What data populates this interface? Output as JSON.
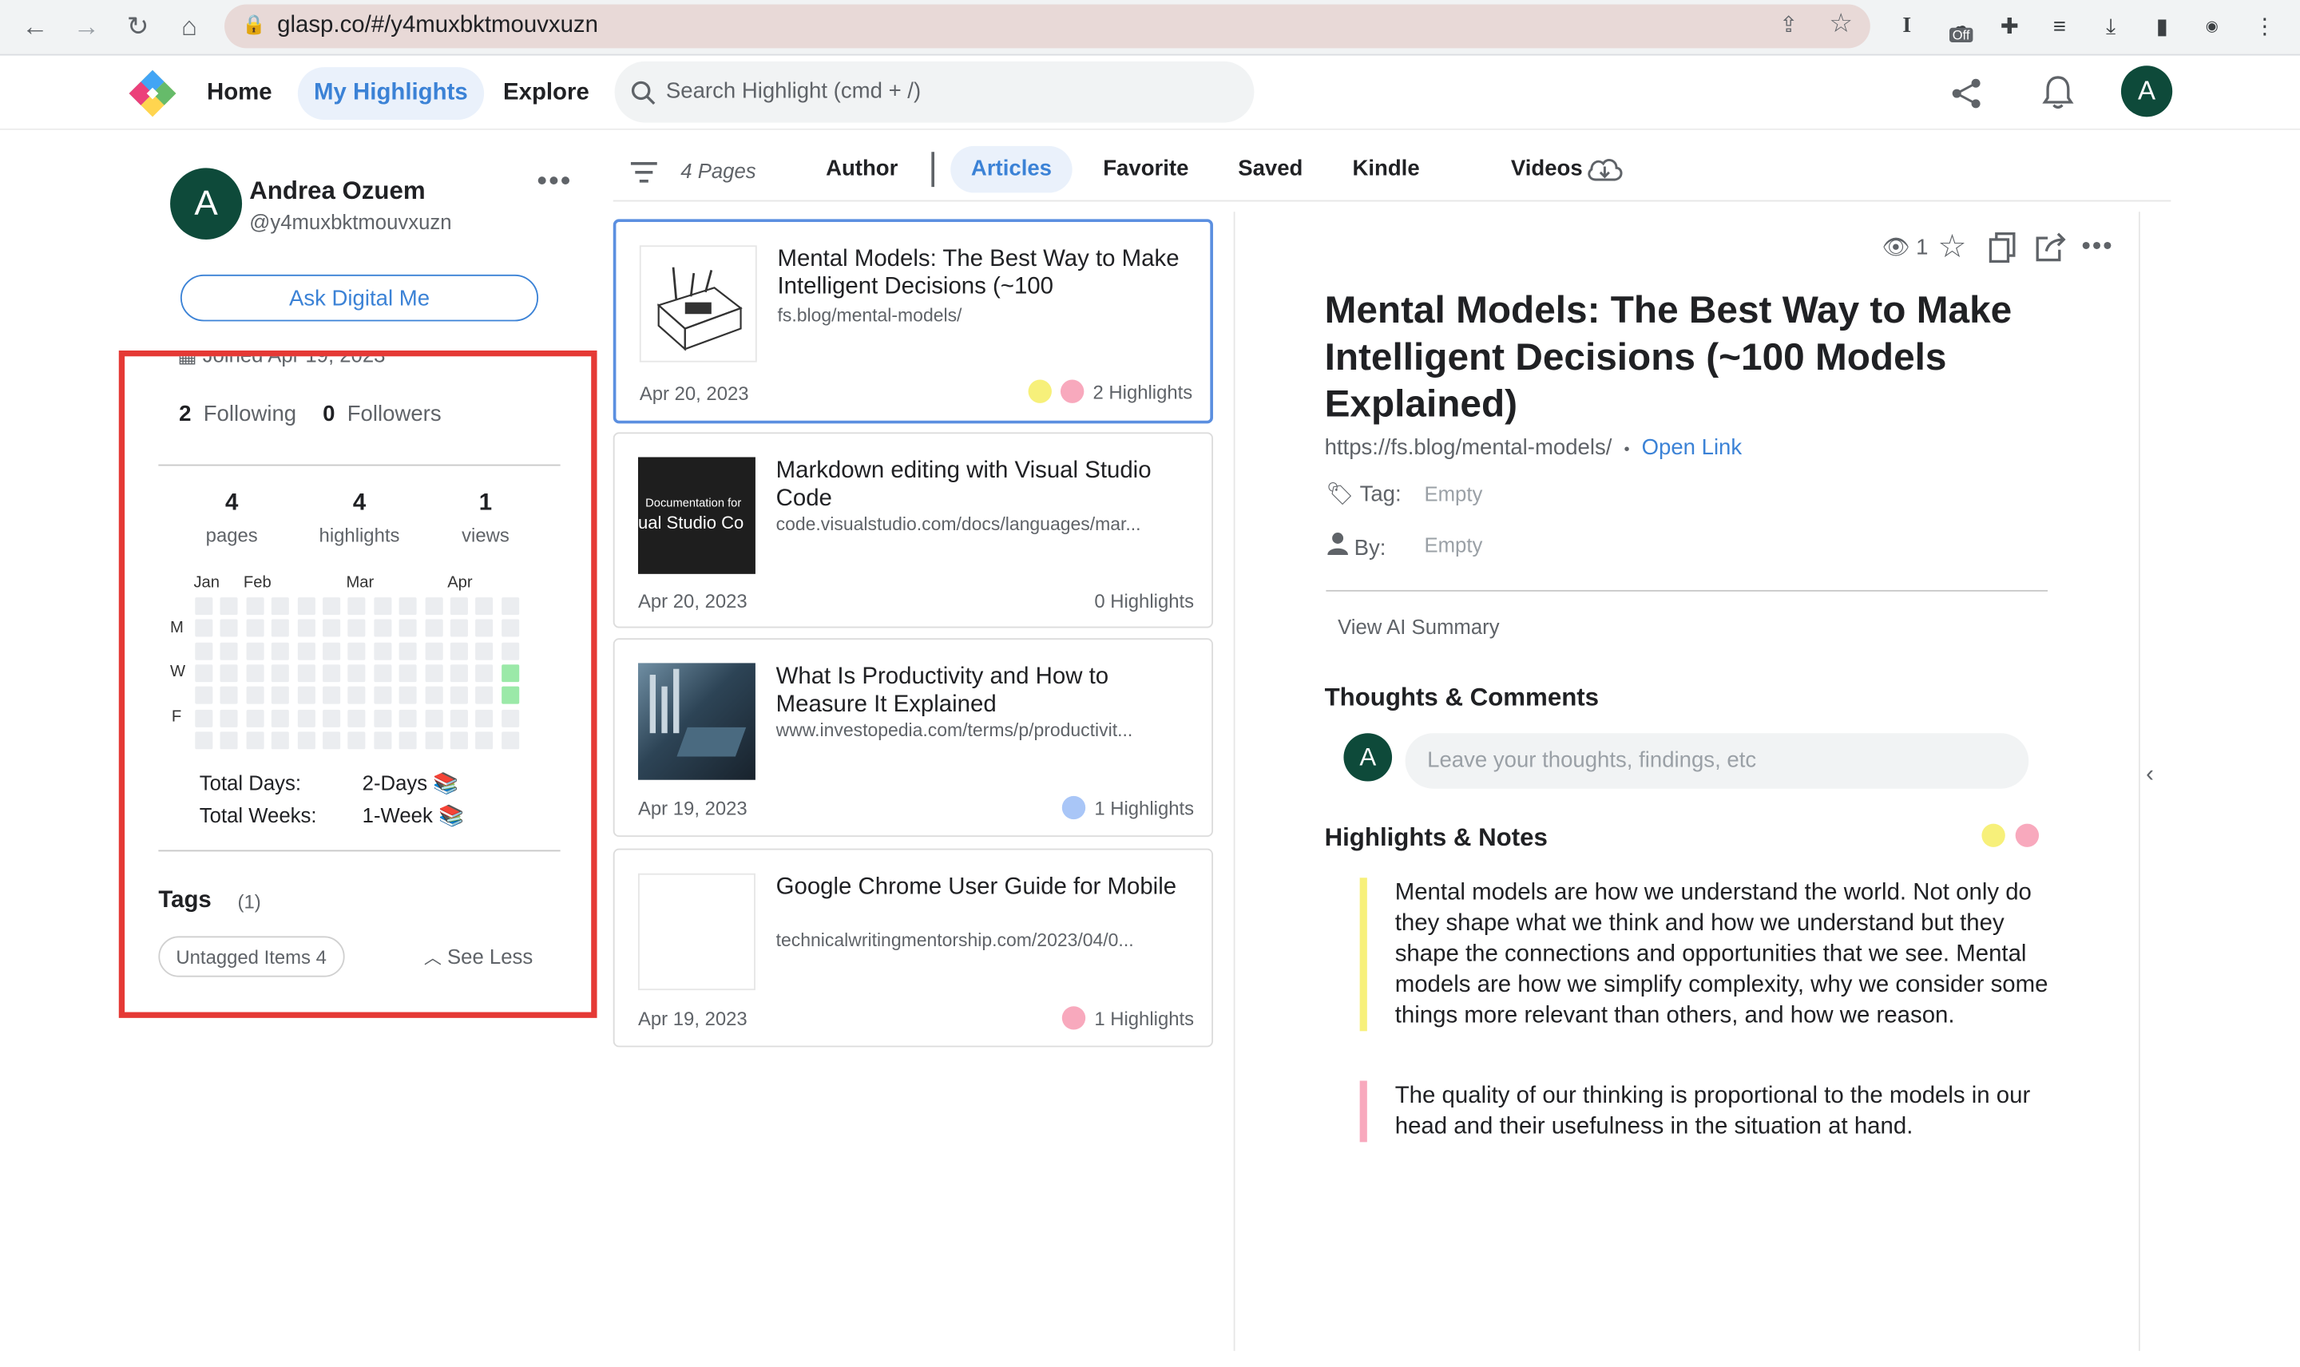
{
  "browser": {
    "url": "glasp.co/#/y4muxbktmouvxuzn",
    "ext_badge": "Off"
  },
  "header": {
    "nav": [
      "Home",
      "My Highlights",
      "Explore"
    ],
    "search_placeholder": "Search Highlight (cmd + /)",
    "avatar_letter": "A"
  },
  "profile": {
    "avatar_letter": "A",
    "name": "Andrea Ozuem",
    "handle": "@y4muxbktmouvxuzn",
    "ask_button": "Ask Digital Me",
    "joined": "Joined Apr 19, 2023",
    "following_count": "2",
    "following_label": "Following",
    "followers_count": "0",
    "followers_label": "Followers",
    "stats": [
      {
        "num": "4",
        "label": "pages"
      },
      {
        "num": "4",
        "label": "highlights"
      },
      {
        "num": "1",
        "label": "views"
      }
    ],
    "months": [
      "Jan",
      "Feb",
      "Mar",
      "Apr"
    ],
    "days": [
      "M",
      "W",
      "F"
    ],
    "total_days_label": "Total Days:",
    "total_days_value": "2-Days 📚",
    "total_weeks_label": "Total Weeks:",
    "total_weeks_value": "1-Week 📚",
    "tags_title": "Tags",
    "tags_count": "(1)",
    "untagged": "Untagged Items 4",
    "see_less": "See Less"
  },
  "filters": {
    "pages": "4 Pages",
    "items": [
      "Author",
      "Articles",
      "Favorite",
      "Saved",
      "Kindle",
      "Videos"
    ]
  },
  "cards": [
    {
      "title": "Mental Models: The Best Way to Make Intelligent Decisions (~100",
      "url": "fs.blog/mental-models/",
      "date": "Apr 20, 2023",
      "highlights": "2 Highlights"
    },
    {
      "title": "Markdown editing with Visual Studio Code",
      "url": "code.visualstudio.com/docs/languages/mar...",
      "date": "Apr 20, 2023",
      "highlights": "0 Highlights",
      "thumb_small": "Documentation for",
      "thumb_big": "ual Studio Co"
    },
    {
      "title": "What Is Productivity and How to Measure It Explained",
      "url": "www.investopedia.com/terms/p/productivit...",
      "date": "Apr 19, 2023",
      "highlights": "1 Highlights"
    },
    {
      "title": "Google Chrome User Guide for Mobile",
      "url": "technicalwritingmentorship.com/2023/04/0...",
      "date": "Apr 19, 2023",
      "highlights": "1 Highlights"
    }
  ],
  "colors": {
    "yellow": "#f7f07a",
    "pink": "#f8a9bd",
    "blue": "#a9c6f7",
    "accent": "#3b82d6",
    "red_box": "#e53935"
  },
  "detail": {
    "views": "1",
    "title": "Mental Models: The Best Way to Make Intelligent Decisions (~100 Models Explained)",
    "url": "https://fs.blog/mental-models/",
    "sep": "•",
    "open_link": "Open Link",
    "tag_label": "Tag:",
    "tag_value": "Empty",
    "by_label": "By:",
    "by_value": "Empty",
    "ai_summary": "View AI Summary",
    "thoughts_title": "Thoughts & Comments",
    "thoughts_placeholder": "Leave your thoughts, findings, etc",
    "avatar_letter": "A",
    "highlights_title": "Highlights & Notes",
    "highlights": [
      "Mental models are how we understand the world. Not only do they shape what we think and how we understand but they shape the connections and opportunities that we see. Mental models are how we simplify complexity, why we consider some things more relevant than others, and how we reason.",
      "The quality of our thinking is proportional to the models in our head and their usefulness in the situation at hand."
    ]
  }
}
